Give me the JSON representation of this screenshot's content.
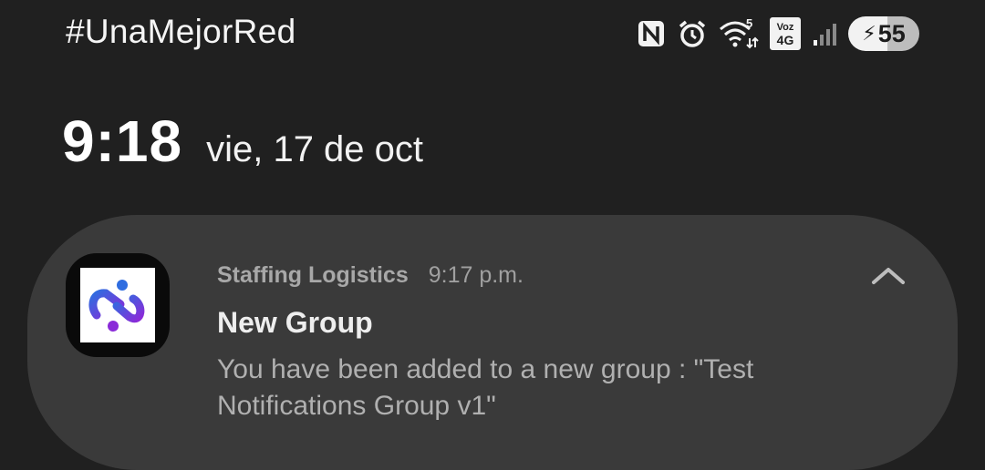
{
  "status_bar": {
    "carrier": "#UnaMejorRed",
    "icons": [
      "nfc-icon",
      "alarm-icon",
      "wifi-icon",
      "volte-4g-icon",
      "signal-icon"
    ],
    "wifi_label": "5",
    "voz_label": "Voz",
    "lte_label": "4G",
    "battery_level": "55"
  },
  "lockscreen": {
    "time": "9:18",
    "date": "vie, 17 de oct"
  },
  "notification": {
    "app_name": "Staffing Logistics",
    "time": "9:17 p.m.",
    "title": "New Group",
    "body": "You have been added to a new group : \"Test Notifications Group v1\"",
    "app_icon": "staffing-logistics-logo",
    "expand_icon": "chevron-up-icon"
  },
  "colors": {
    "background": "#202020",
    "card": "#3a3a3a",
    "logo_gradient_start": "#2f6de0",
    "logo_gradient_end": "#8a2bd8"
  }
}
